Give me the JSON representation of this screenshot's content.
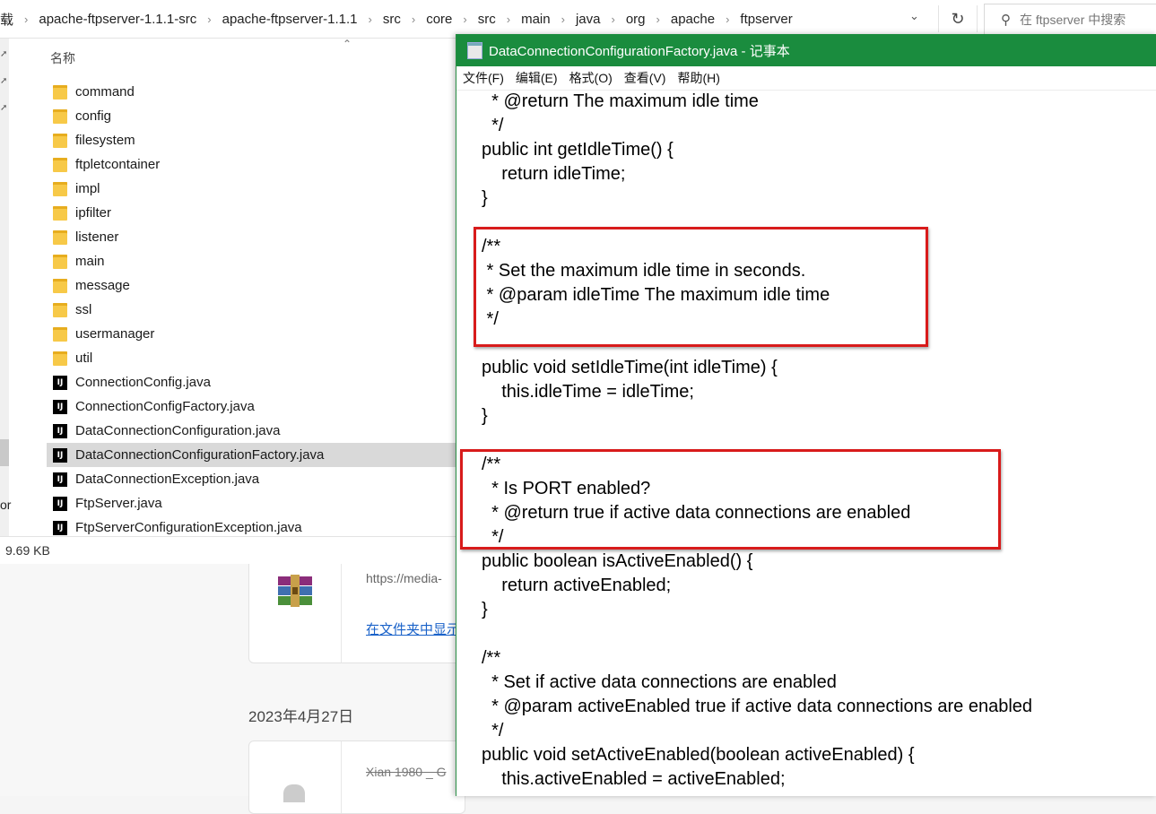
{
  "explorer": {
    "breadcrumbs": [
      "载",
      "apache-ftpserver-1.1.1-src",
      "apache-ftpserver-1.1.1",
      "src",
      "core",
      "src",
      "main",
      "java",
      "org",
      "apache",
      "ftpserver"
    ],
    "search_placeholder": "在 ftpserver 中搜索",
    "column_header": "名称",
    "nav_partial_text": "or",
    "files": [
      {
        "name": "command",
        "type": "folder"
      },
      {
        "name": "config",
        "type": "folder"
      },
      {
        "name": "filesystem",
        "type": "folder"
      },
      {
        "name": "ftpletcontainer",
        "type": "folder"
      },
      {
        "name": "impl",
        "type": "folder"
      },
      {
        "name": "ipfilter",
        "type": "folder"
      },
      {
        "name": "listener",
        "type": "folder"
      },
      {
        "name": "main",
        "type": "folder"
      },
      {
        "name": "message",
        "type": "folder"
      },
      {
        "name": "ssl",
        "type": "folder"
      },
      {
        "name": "usermanager",
        "type": "folder"
      },
      {
        "name": "util",
        "type": "folder"
      },
      {
        "name": "ConnectionConfig.java",
        "type": "java"
      },
      {
        "name": "ConnectionConfigFactory.java",
        "type": "java"
      },
      {
        "name": "DataConnectionConfiguration.java",
        "type": "java"
      },
      {
        "name": "DataConnectionConfigurationFactory.java",
        "type": "java",
        "selected": true
      },
      {
        "name": "DataConnectionException.java",
        "type": "java"
      },
      {
        "name": "FtpServer.java",
        "type": "java"
      },
      {
        "name": "FtpServerConfigurationException.java",
        "type": "java"
      }
    ],
    "status_size": "9.69 KB"
  },
  "background": {
    "download_url": "https://media-",
    "show_in_folder": "在文件夹中显示",
    "date": "2023年4月27日",
    "second_item": "Xian 1980 _ G"
  },
  "notepad": {
    "title": "DataConnectionConfigurationFactory.java - 记事本",
    "menu": [
      "文件(F)",
      "编辑(E)",
      "格式(O)",
      "查看(V)",
      "帮助(H)"
    ],
    "lines": [
      "  * @return The maximum idle time",
      "  */",
      "public int getIdleTime() {",
      "    return idleTime;",
      "}",
      "",
      "/**",
      " * Set the maximum idle time in seconds.",
      " * @param idleTime The maximum idle time",
      " */",
      "",
      "public void setIdleTime(int idleTime) {",
      "    this.idleTime = idleTime;",
      "}",
      "",
      "/**",
      "  * Is PORT enabled?",
      "  * @return true if active data connections are enabled",
      "  */",
      "public boolean isActiveEnabled() {",
      "    return activeEnabled;",
      "}",
      "",
      "/**",
      "  * Set if active data connections are enabled",
      "  * @param activeEnabled true if active data connections are enabled",
      "  */",
      "public void setActiveEnabled(boolean activeEnabled) {",
      "    this.activeEnabled = activeEnabled;"
    ]
  },
  "colors": {
    "notepad_title": "#1a8c3e",
    "highlight_box": "#d81b1b",
    "selection": "#d9d9d9"
  },
  "icons": [
    "folder-icon",
    "intellij-file-icon",
    "search-icon",
    "refresh-icon",
    "chevron-down-icon",
    "winrar-icon",
    "notepad-icon"
  ]
}
